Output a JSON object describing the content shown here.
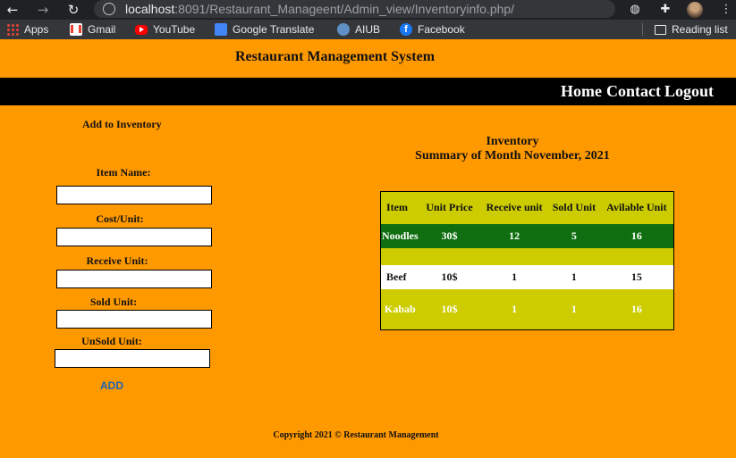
{
  "browser": {
    "url_host": "localhost",
    "url_path": ":8091/Restaurant_Manageent/Admin_view/Inventoryinfo.php/",
    "bookmarks": [
      {
        "label": "Apps",
        "icon": "apps-icon"
      },
      {
        "label": "Gmail",
        "icon": "gmail-icon"
      },
      {
        "label": "YouTube",
        "icon": "youtube-icon"
      },
      {
        "label": "Google Translate",
        "icon": "google-translate-icon"
      },
      {
        "label": "AIUB",
        "icon": "aiub-icon"
      },
      {
        "label": "Facebook",
        "icon": "facebook-icon"
      }
    ],
    "reading_list": "Reading list"
  },
  "site": {
    "title": "Restaurant Management System",
    "nav": {
      "home": "Home",
      "contact": "Contact",
      "logout": "Logout"
    }
  },
  "form": {
    "title": "Add to Inventory",
    "fields": [
      {
        "label": "Item Name:",
        "value": ""
      },
      {
        "label": "Cost/Unit:",
        "value": ""
      },
      {
        "label": "Receive Unit:",
        "value": ""
      },
      {
        "label": "Sold Unit:",
        "value": ""
      },
      {
        "label": "UnSold Unit:",
        "value": ""
      }
    ],
    "add_label": "ADD"
  },
  "inventory": {
    "heading": "Inventory",
    "subheading": "Summary of Month November, 2021",
    "columns": [
      "Item",
      "Unit Price",
      "Receive unit",
      "Sold Unit",
      "Avilable Unit"
    ],
    "rows": [
      {
        "item": "Noodles",
        "unit_price": "30$",
        "receive": "12",
        "sold": "5",
        "available": "16"
      },
      {
        "item": "Beef",
        "unit_price": "10$",
        "receive": "1",
        "sold": "1",
        "available": "15"
      },
      {
        "item": "Kabab",
        "unit_price": "10$",
        "receive": "1",
        "sold": "1",
        "available": "16"
      }
    ]
  },
  "footer": "Copyright 2021 © Restaurant Management",
  "colors": {
    "page_bg": "#ff9900",
    "navbar_bg": "#000000",
    "table_bg": "#cccc00",
    "highlight_row": "#0f6e0f",
    "link": "#1e63b6"
  }
}
